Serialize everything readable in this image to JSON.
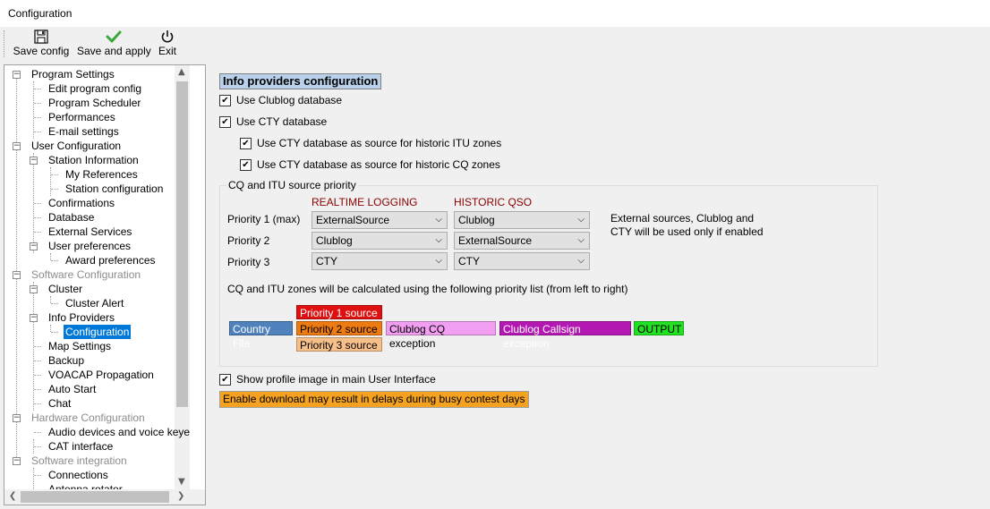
{
  "window": {
    "title": "Configuration"
  },
  "toolbar": {
    "save_config": "Save config",
    "save_apply": "Save and apply",
    "exit": "Exit"
  },
  "tree": {
    "nodes": [
      {
        "label": "Program Settings",
        "level": 0,
        "disabled": false,
        "expander": "-"
      },
      {
        "label": "Edit program config",
        "level": 1
      },
      {
        "label": "Program Scheduler",
        "level": 1
      },
      {
        "label": "Performances",
        "level": 1
      },
      {
        "label": "E-mail settings",
        "level": 1
      },
      {
        "label": "User Configuration",
        "level": 0,
        "expander": "-"
      },
      {
        "label": "Station Information",
        "level": 1,
        "expander": "-"
      },
      {
        "label": "My References",
        "level": 2
      },
      {
        "label": "Station configuration",
        "level": 2
      },
      {
        "label": "Confirmations",
        "level": 1
      },
      {
        "label": "Database",
        "level": 1
      },
      {
        "label": "External Services",
        "level": 1
      },
      {
        "label": "User preferences",
        "level": 1,
        "expander": "-"
      },
      {
        "label": "Award preferences",
        "level": 2
      },
      {
        "label": "Software Configuration",
        "level": 0,
        "disabled": true,
        "expander": "-"
      },
      {
        "label": "Cluster",
        "level": 1,
        "expander": "-"
      },
      {
        "label": "Cluster Alert",
        "level": 2
      },
      {
        "label": "Info Providers",
        "level": 1,
        "expander": "-"
      },
      {
        "label": "Configuration",
        "level": 2,
        "selected": true
      },
      {
        "label": "Map Settings",
        "level": 1
      },
      {
        "label": "Backup",
        "level": 1
      },
      {
        "label": "VOACAP Propagation",
        "level": 1
      },
      {
        "label": "Auto Start",
        "level": 1
      },
      {
        "label": "Chat",
        "level": 1
      },
      {
        "label": "Hardware Configuration",
        "level": 0,
        "disabled": true,
        "expander": "-"
      },
      {
        "label": "Audio devices and voice keyer",
        "level": 1
      },
      {
        "label": "CAT interface",
        "level": 1
      },
      {
        "label": "Software integration",
        "level": 0,
        "disabled": true,
        "expander": "-"
      },
      {
        "label": "Connections",
        "level": 1
      },
      {
        "label": "Antenna rotator",
        "level": 1
      }
    ]
  },
  "panel": {
    "heading": "Info providers configuration",
    "use_clublog": "Use Clublog database",
    "use_cty": "Use CTY database",
    "cty_itu": "Use CTY database as source for historic ITU zones",
    "cty_cq": "Use CTY database as source for historic CQ zones",
    "group_title": "CQ and ITU source priority",
    "col_realtime": "REALTIME LOGGING",
    "col_historic": "HISTORIC QSO",
    "rows": [
      {
        "label": "Priority 1 (max)",
        "realtime": "ExternalSource",
        "historic": "Clublog"
      },
      {
        "label": "Priority 2",
        "realtime": "Clublog",
        "historic": "ExternalSource"
      },
      {
        "label": "Priority 3",
        "realtime": "CTY",
        "historic": "CTY"
      }
    ],
    "note_line1": "External sources, Clublog and",
    "note_line2": "CTY will be used only if enabled",
    "calc_text": "CQ and ITU zones will be calculated using the following priority list (from left to right)",
    "flow": {
      "country_file": "Country File",
      "p1": "Priority 1 source",
      "p2": "Priority 2 source",
      "p3": "Priority 3 source",
      "clublog_cq": "Clublog CQ exception",
      "clublog_call": "Clublog Callsign exception",
      "output": "OUTPUT"
    },
    "show_profile": "Show profile image in main User Interface",
    "warning": "Enable download may result in delays during busy contest days"
  }
}
